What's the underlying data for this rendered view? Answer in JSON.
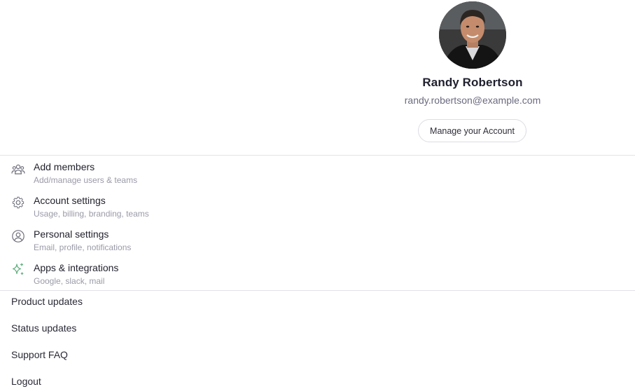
{
  "profile": {
    "name": "Randy Robertson",
    "email": "randy.robertson@example.com",
    "manage_label": "Manage your Account"
  },
  "menu": {
    "items": [
      {
        "title": "Add members",
        "subtitle": "Add/manage users & teams",
        "icon": "users-icon"
      },
      {
        "title": "Account settings",
        "subtitle": "Usage, billing, branding, teams",
        "icon": "gear-icon"
      },
      {
        "title": "Personal settings",
        "subtitle": "Email, profile, notifications",
        "icon": "user-circle-icon"
      },
      {
        "title": "Apps & integrations",
        "subtitle": "Google, slack, mail",
        "icon": "sparkle-icon"
      }
    ]
  },
  "links": {
    "items": [
      {
        "label": "Product updates"
      },
      {
        "label": "Status updates"
      },
      {
        "label": "Support FAQ"
      },
      {
        "label": "Logout"
      }
    ]
  },
  "colors": {
    "sparkle_accent": "#5fae7d",
    "icon_gray": "#6f6f7c",
    "divider": "#e3e3e8"
  }
}
